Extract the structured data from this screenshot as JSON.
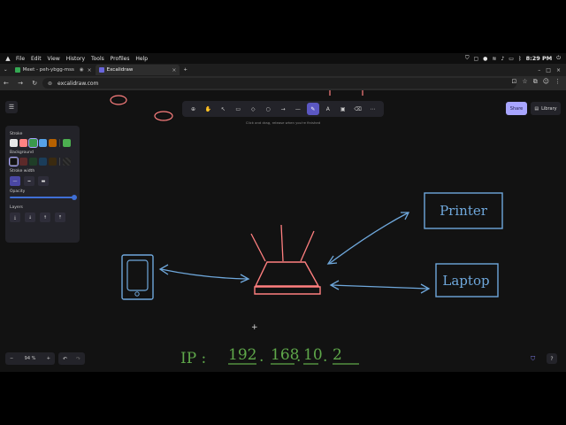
{
  "os_bar": {
    "menus": [
      "File",
      "Edit",
      "View",
      "History",
      "Tools",
      "Profiles",
      "Help"
    ],
    "time": "8:29 PM"
  },
  "tabs": [
    {
      "label": "Meet - peh-ybgg-mss",
      "active": false
    },
    {
      "label": "Excalidraw",
      "active": true
    }
  ],
  "url": "excalidraw.com",
  "app": {
    "hint": "Click and drag, release when you're finished",
    "share_label": "Share",
    "library_label": "Library",
    "properties": {
      "stroke_label": "Stroke",
      "background_label": "Background",
      "stroke_width_label": "Stroke width",
      "opacity_label": "Opacity",
      "layers_label": "Layers",
      "stroke_colors": [
        "#e8e8e8",
        "#ff8383",
        "#3a994c",
        "#56a2e8",
        "#b76100",
        "#4caf50"
      ],
      "background_colors": [
        "#121212",
        "#5c2a2a",
        "#1f3d27",
        "#1b3d5a",
        "#3a2a10"
      ]
    },
    "zoom": "94 %"
  },
  "canvas": {
    "printer_label": "Printer",
    "laptop_label": "Laptop",
    "ip_prefix": "IP :",
    "ip_parts": [
      "192",
      "168",
      "10",
      "2"
    ],
    "colors": {
      "blue": "#6fa8dc",
      "red": "#ff7f7f",
      "green": "#5fa84a"
    }
  }
}
